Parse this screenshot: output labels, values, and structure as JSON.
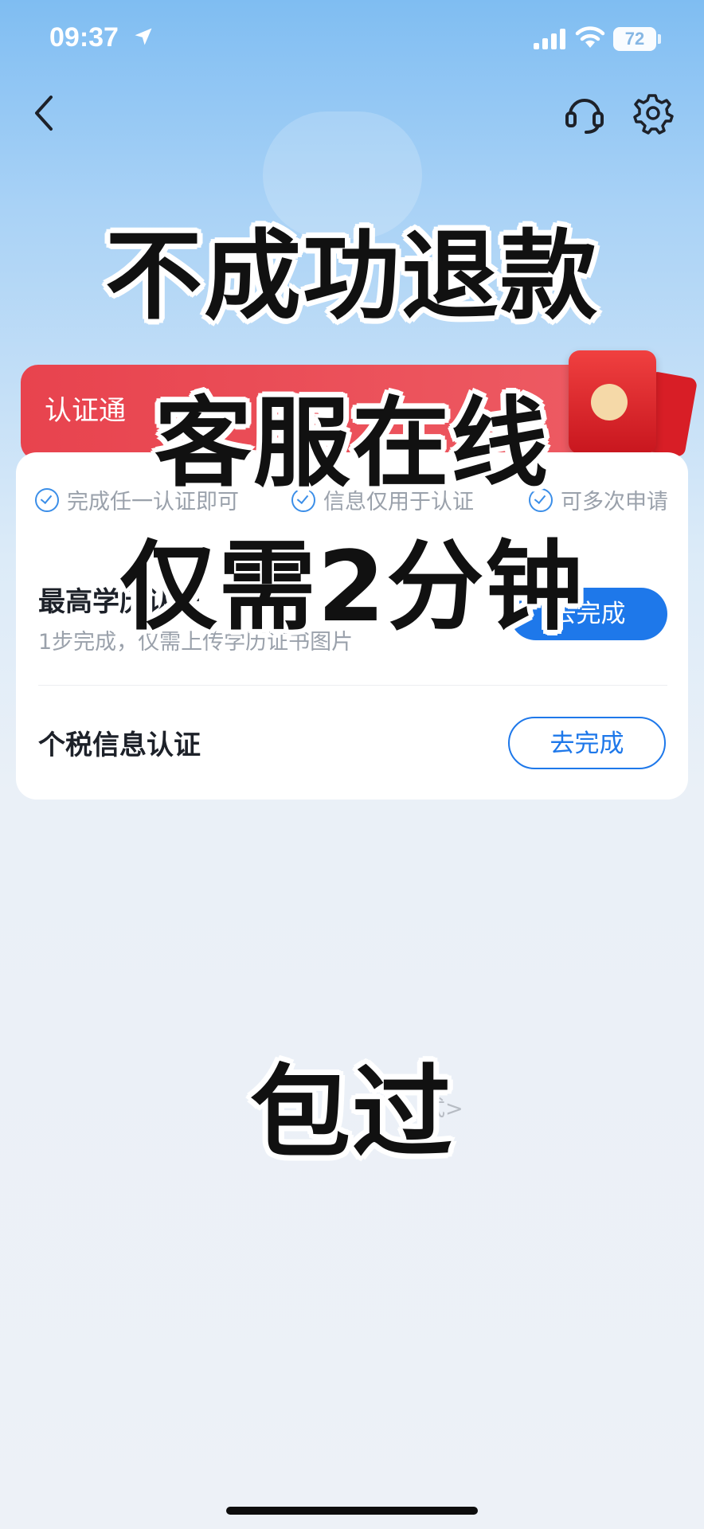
{
  "status_bar": {
    "time": "09:37",
    "battery": "72"
  },
  "banner": {
    "label": "认证通"
  },
  "card": {
    "tips": [
      "完成任一认证即可",
      "信息仅用于认证",
      "可多次申请"
    ],
    "item1": {
      "title": "最高学历认证",
      "desc": "1步完成，仅需上传学历证书图片",
      "button": "去完成"
    },
    "item2": {
      "title": "个税信息认证",
      "button": "去完成"
    }
  },
  "faint_link": "式>",
  "overlay": {
    "line1": "不成功退款",
    "line2": "客服在线",
    "line3": "仅需2分钟",
    "line4": "包过"
  },
  "icons": [
    "location-arrow-icon",
    "signal-icon",
    "wifi-icon",
    "back-icon",
    "customer-service-icon",
    "gear-icon",
    "check-circle-icon",
    "red-packet-icon"
  ],
  "colors": {
    "accent": "#1e78ea",
    "banner": "#e8434e"
  }
}
